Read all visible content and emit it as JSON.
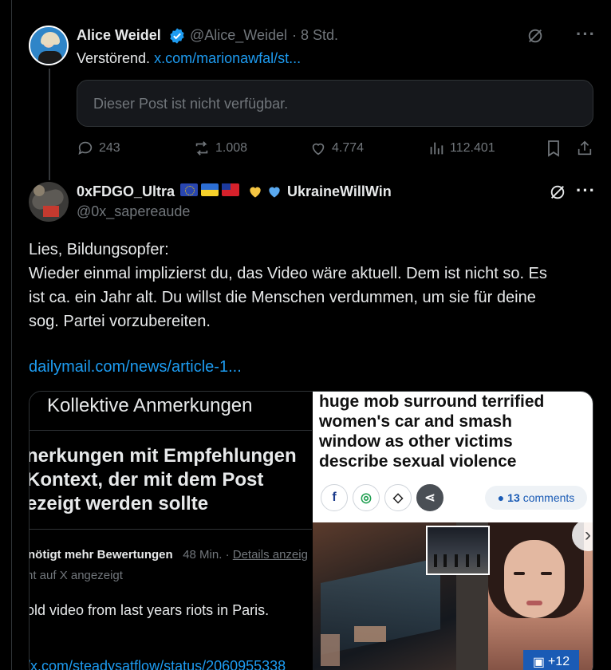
{
  "tweet1": {
    "name": "Alice Weidel",
    "handle": "@Alice_Weidel",
    "separator": "·",
    "time": "8 Std.",
    "text": "Verstörend.",
    "link": "x.com/marionawfal/st...",
    "quoted_unavailable": "Dieser Post ist nicht verfügbar.",
    "replies": "243",
    "reposts": "1.008",
    "likes": "4.774",
    "views": "112.401"
  },
  "tweet2": {
    "name": "0xFDGO_Ultra",
    "name_suffix": "UkraineWillWin",
    "handle": "@0x_sapereaude",
    "lines": [
      "Lies, Bildungsopfer:",
      "Wieder einmal implizierst du, das Video wäre aktuell. Dem ist nicht so. Es",
      "ist ca. ein Jahr alt. Du willst die Menschen verdummen, um sie für deine",
      "sog. Partei vorzubereiten."
    ],
    "link": "dailymail.com/news/article-1..."
  },
  "media_left": {
    "title": "Kollektive Anmerkungen",
    "headline_lines": [
      "nerkungen mit Empfehlungen",
      "Kontext, der mit dem Post",
      "ezeigt werden sollte"
    ],
    "meta_status": "nötigt mehr Bewertungen",
    "meta_time": "48 Min.",
    "meta_dot": "·",
    "meta_link": "Details anzeig",
    "sub": "nt auf X angezeigt",
    "note": "old video from last years riots in Paris.",
    "colon": ":",
    "url": "/x.com/steadysatflow/status/2060955338"
  },
  "media_right": {
    "headline_lines": [
      "huge mob surround terrified",
      "women's car and smash",
      "window as other victims",
      "describe sexual violence"
    ],
    "comments_count": "13",
    "comments_label": "comments",
    "gallery_count": "+12"
  },
  "colors": {
    "accent": "#1d9bf0",
    "muted": "#71767b",
    "background": "#000000"
  }
}
